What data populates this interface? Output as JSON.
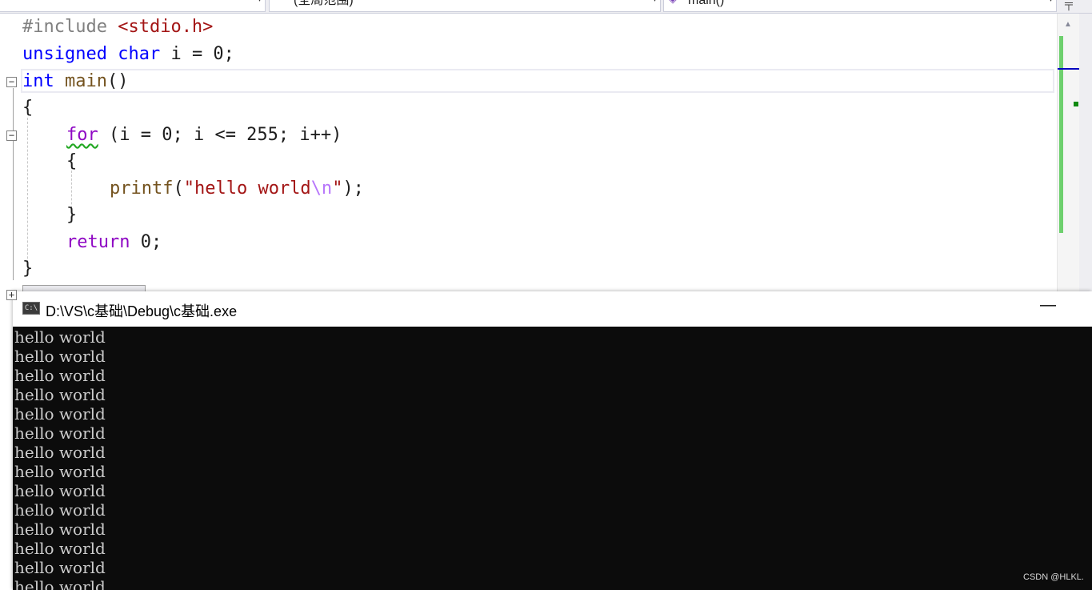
{
  "navbar": {
    "project_combo": "",
    "scope_combo": "(全局范围)",
    "member_combo": "main()",
    "member_icon": "method-icon",
    "split_icon": "split-window-icon"
  },
  "editor": {
    "line1": {
      "directive": "#include",
      "header": "<stdio.h>"
    },
    "line2": {
      "kw1": "unsigned",
      "kw2": "char",
      "rest": " i = 0;"
    },
    "line3": {
      "kw": "int",
      "fn": "main",
      "rest": "()"
    },
    "line4": {
      "text": "{"
    },
    "line5": {
      "kw": "for",
      "rest": " (i = 0; i <= 255; i++)"
    },
    "line6": {
      "text": "{"
    },
    "line7": {
      "fn": "printf",
      "open": "(",
      "str1": "\"hello world",
      "esc": "\\n",
      "str2": "\"",
      "close": ");"
    },
    "line8": {
      "text": "}"
    },
    "line9": {
      "kw": "return",
      "rest": " 0;"
    },
    "line10": {
      "text": "}"
    },
    "fold_minus": "−",
    "fold_plus": "+"
  },
  "colors": {
    "keyword": "#0000ff",
    "control_keyword": "#8f08c4",
    "function": "#74531f",
    "string": "#a31515",
    "escape": "#b776fb",
    "preprocessor": "#808080",
    "change_marker": "#6ed06e"
  },
  "console": {
    "title": "D:\\VS\\c基础\\Debug\\c基础.exe",
    "icon_label": "C:\\",
    "minimize_label": "—",
    "output_lines": [
      "hello world",
      "hello world",
      "hello world",
      "hello world",
      "hello world",
      "hello world",
      "hello world",
      "hello world",
      "hello world",
      "hello world",
      "hello world",
      "hello world",
      "hello world",
      "hello world"
    ]
  },
  "watermark": "CSDN @HLKL."
}
